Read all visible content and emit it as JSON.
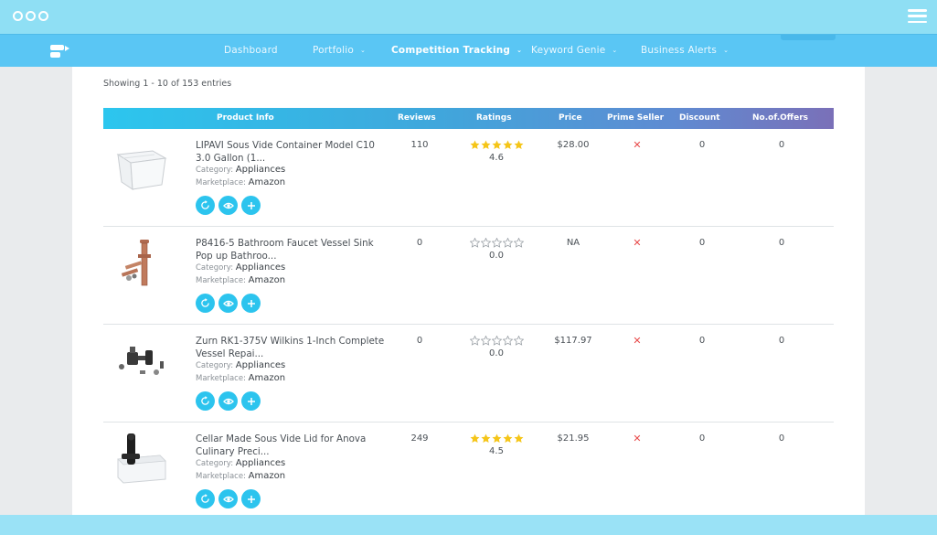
{
  "nav": {
    "items": [
      {
        "label": "Dashboard",
        "dropdown": false,
        "active": false
      },
      {
        "label": "Portfolio",
        "dropdown": true,
        "active": false
      },
      {
        "label": "Competition Tracking",
        "dropdown": true,
        "active": true
      },
      {
        "label": "Keyword Genie",
        "dropdown": true,
        "active": false
      },
      {
        "label": "Business Alerts",
        "dropdown": true,
        "active": false
      }
    ]
  },
  "table": {
    "info": "Showing 1 - 10 of 153 entries",
    "columns": {
      "product": "Product Info",
      "reviews": "Reviews",
      "ratings": "Ratings",
      "price": "Price",
      "prime": "Prime Seller",
      "discount": "Discount",
      "offers": "No.of.Offers"
    },
    "category_label": "Category:",
    "marketplace_label": "Marketplace:",
    "prime_no_symbol": "✕",
    "rows": [
      {
        "name": "LIPAVI Sous Vide Container Model C10 3.0 Gallon (1...",
        "category": "Appliances",
        "marketplace": "Amazon",
        "reviews": "110",
        "rating": "4.6",
        "stars": 5,
        "price": "$28.00",
        "discount": "0",
        "offers": "0",
        "image_icon": "container-product-image"
      },
      {
        "name": "P8416-5 Bathroom Faucet Vessel Sink Pop up Bathroo...",
        "category": "Appliances",
        "marketplace": "Amazon",
        "reviews": "0",
        "rating": "0.0",
        "stars": 0,
        "price": "NA",
        "discount": "0",
        "offers": "0",
        "image_icon": "drain-product-image"
      },
      {
        "name": "Zurn RK1-375V Wilkins 1-Inch Complete Vessel Repai...",
        "category": "Appliances",
        "marketplace": "Amazon",
        "reviews": "0",
        "rating": "0.0",
        "stars": 0,
        "price": "$117.97",
        "discount": "0",
        "offers": "0",
        "image_icon": "valve-kit-product-image"
      },
      {
        "name": "Cellar Made Sous Vide Lid for Anova Culinary Preci...",
        "category": "Appliances",
        "marketplace": "Amazon",
        "reviews": "249",
        "rating": "4.5",
        "stars": 5,
        "price": "$21.95",
        "discount": "0",
        "offers": "0",
        "image_icon": "sous-vide-lid-product-image"
      }
    ],
    "actions": [
      "refresh-icon",
      "view-icon",
      "add-icon"
    ]
  },
  "colors": {
    "chrome": "#8fdff4",
    "nav": "#5ac6f4",
    "accent": "#2cc4ee",
    "star": "#f5c518",
    "star_empty": "#9aa0a6",
    "no_prime": "#e84b4b"
  }
}
